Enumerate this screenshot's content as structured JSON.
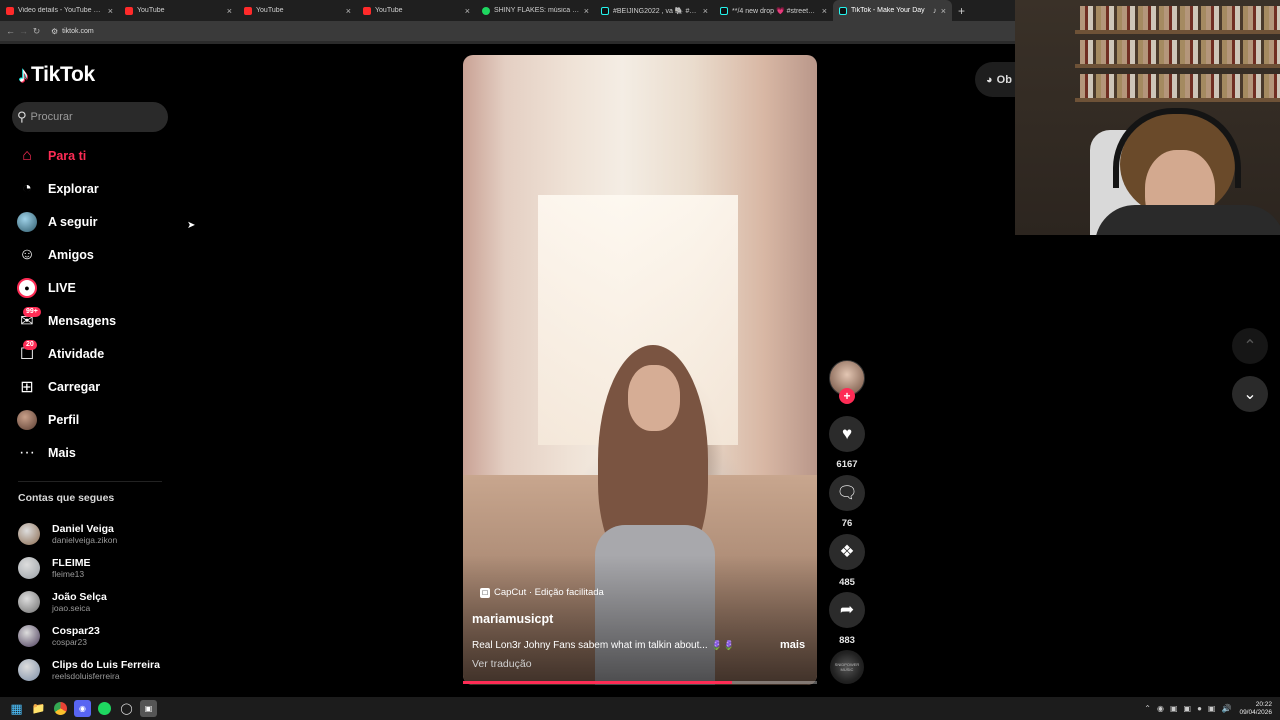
{
  "browser": {
    "tabs": [
      {
        "title": "Video details - YouTube Studio",
        "icon": "youtube-icon",
        "active": false
      },
      {
        "title": "YouTube",
        "icon": "youtube-icon",
        "active": false
      },
      {
        "title": "YouTube",
        "icon": "youtube-icon",
        "active": false
      },
      {
        "title": "YouTube",
        "icon": "youtube-icon",
        "active": false
      },
      {
        "title": "SHINY FLAKES: música e letra d",
        "icon": "spotify-icon",
        "active": false
      },
      {
        "title": "#BEIJING2022 , va 🐘 #annash",
        "icon": "tiktok-icon",
        "active": false
      },
      {
        "title": "**/4 new drop 💗 #streetwear",
        "icon": "tiktok-icon",
        "active": false
      },
      {
        "title": "TikTok - Make Your Day",
        "icon": "tiktok-icon",
        "active": true
      }
    ],
    "url": "tiktok.com"
  },
  "sidebar": {
    "logo": "TikTok",
    "search_placeholder": "Procurar",
    "nav": [
      {
        "label": "Para ti",
        "icon": "home-icon",
        "active": true
      },
      {
        "label": "Explorar",
        "icon": "compass-icon"
      },
      {
        "label": "A seguir",
        "icon": "following-avatar-icon"
      },
      {
        "label": "Amigos",
        "icon": "friends-icon"
      },
      {
        "label": "LIVE",
        "icon": "live-icon"
      },
      {
        "label": "Mensagens",
        "icon": "messages-icon",
        "badge": "99+"
      },
      {
        "label": "Atividade",
        "icon": "activity-icon",
        "badge": "20"
      },
      {
        "label": "Carregar",
        "icon": "upload-icon"
      },
      {
        "label": "Perfil",
        "icon": "profile-avatar-icon"
      },
      {
        "label": "Mais",
        "icon": "more-icon"
      }
    ],
    "following_title": "Contas que segues",
    "following": [
      {
        "name": "Daniel Veiga",
        "handle": "danielveiga.zikon",
        "color": "#8a6a4f"
      },
      {
        "name": "FLEIME",
        "handle": "fleime13",
        "color": "#9aa0a6"
      },
      {
        "name": "João Selça",
        "handle": "joao.seica",
        "color": "#6e6e6e"
      },
      {
        "name": "Cospar23",
        "handle": "cospar23",
        "color": "#4a3b5a"
      },
      {
        "name": "Clips do Luis Ferreira",
        "handle": "reelsdoluisferreira",
        "color": "#7c8fa8"
      }
    ]
  },
  "video": {
    "capcut_label": "CapCut · Edição facilitada",
    "creator": "mariamusicpt",
    "caption": "Real Lon3r Johny Fans sabem what im talkin about... 🪻🪻",
    "more_label": "mais",
    "translate_label": "Ver tradução",
    "progress": 0.76
  },
  "actions": {
    "likes": "6167",
    "comments": "76",
    "saves": "485",
    "shares": "883",
    "music_disc_text": "SNIDPOWER MUSIC"
  },
  "right": {
    "get_app_label": "Ob"
  },
  "taskbar": {
    "time": "20:22",
    "date": "09/04/2026"
  },
  "colors": {
    "accent": "#fe2c55",
    "background": "#000000"
  }
}
